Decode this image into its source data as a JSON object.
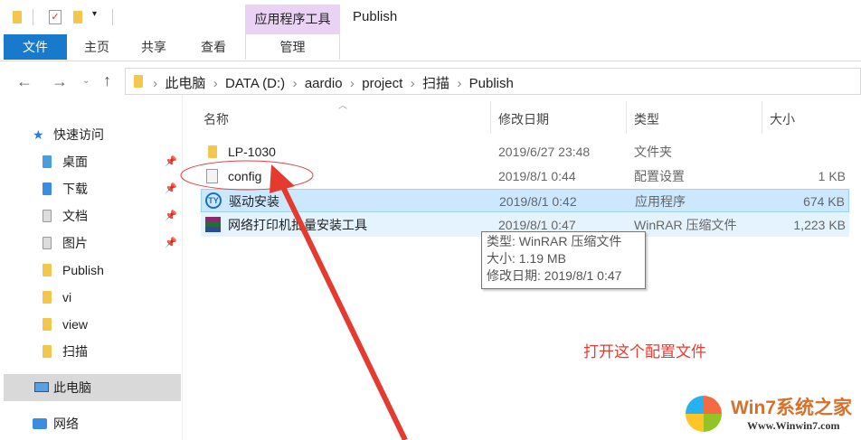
{
  "title_bar": {
    "context_tab": "应用程序工具",
    "title": "Publish"
  },
  "ribbon": {
    "tabs": [
      "文件",
      "主页",
      "共享",
      "查看",
      "管理"
    ]
  },
  "address": {
    "crumbs": [
      "此电脑",
      "DATA (D:)",
      "aardio",
      "project",
      "扫描",
      "Publish"
    ]
  },
  "nav": {
    "quick_access": "快速访问",
    "items": [
      "桌面",
      "下载",
      "文档",
      "图片",
      "Publish",
      "vi",
      "view",
      "扫描"
    ],
    "this_pc": "此电脑",
    "network": "网络"
  },
  "columns": [
    "名称",
    "修改日期",
    "类型",
    "大小"
  ],
  "files": [
    {
      "name": "LP-1030",
      "date": "2019/6/27 23:48",
      "type": "文件夹",
      "size": ""
    },
    {
      "name": "config",
      "date": "2019/8/1 0:44",
      "type": "配置设置",
      "size": "1 KB"
    },
    {
      "name": "驱动安装",
      "date": "2019/8/1 0:42",
      "type": "应用程序",
      "size": "674 KB"
    },
    {
      "name": "网络打印机批量安装工具",
      "date": "2019/8/1 0:47",
      "type": "WinRAR 压缩文件",
      "size": "1,223 KB"
    }
  ],
  "tooltip": {
    "type": "类型: WinRAR 压缩文件",
    "size": "大小: 1.19 MB",
    "date": "修改日期: 2019/8/1 0:47"
  },
  "annotation": "打开这个配置文件",
  "watermark": {
    "brand": "Win7系统之家",
    "url": "Www.Winwin7.com"
  },
  "colors": {
    "accent": "#1979ca",
    "selected": "#cce8ff",
    "hover": "#e5f3ff",
    "context": "#e9d2f4",
    "annotation": "#e53b2f"
  }
}
